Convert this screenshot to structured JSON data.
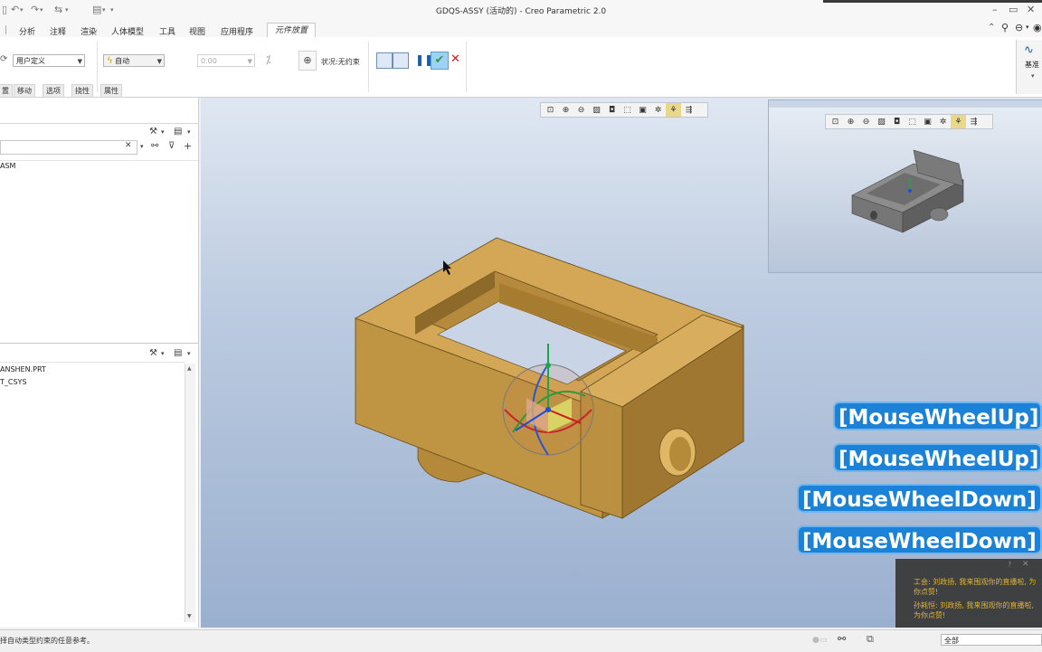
{
  "window": {
    "title": "GDQS-ASSY (活动的) - Creo Parametric 2.0"
  },
  "quick_access": [
    "▯",
    "↶",
    "▾",
    "↷",
    "▾",
    "⇆",
    "▾",
    "▤",
    "▾",
    "▾"
  ],
  "title_controls": {
    "minimize": "–",
    "restore": "▭",
    "close": "✕"
  },
  "ribbon": {
    "tabs": [
      "分析",
      "注释",
      "渲染",
      "人体模型",
      "工具",
      "视图",
      "应用程序"
    ],
    "active_tab": "元件放置",
    "constraint_select": "用户定义",
    "auto_select": "自动",
    "offset_value": "0.00",
    "status_text": "状况:无约束",
    "datum_label": "基准",
    "subtabs": [
      "置",
      "移动",
      "选项",
      "挠性",
      "属性"
    ]
  },
  "left_panel": {
    "model_tree_root": "ASM",
    "lower_tree_items": [
      "ANSHEN.PRT",
      "T_CSYS"
    ]
  },
  "overlays": {
    "keys": [
      "[MouseWheelUp]",
      "[MouseWheelUp]",
      "[MouseWheelDown]",
      "[MouseWheelDown]"
    ]
  },
  "chat": {
    "line1": "工会: 刘政扬, 我来围观你的直播啦, 为你点赞!",
    "line2": "孙耗恒: 刘政扬, 我来围观你的直播啦, 为你点赞!"
  },
  "statusbar": {
    "message": "择自动类型约束的任意参考。",
    "filter": "全部"
  },
  "colors": {
    "model_body": "#c9a14e",
    "viewport_top": "#dfe7f2",
    "viewport_bottom": "#9ab0cf",
    "key_overlay": "#1b82d8",
    "confirm_green": "#2aa04a",
    "cancel_red": "#cc1f1f"
  }
}
